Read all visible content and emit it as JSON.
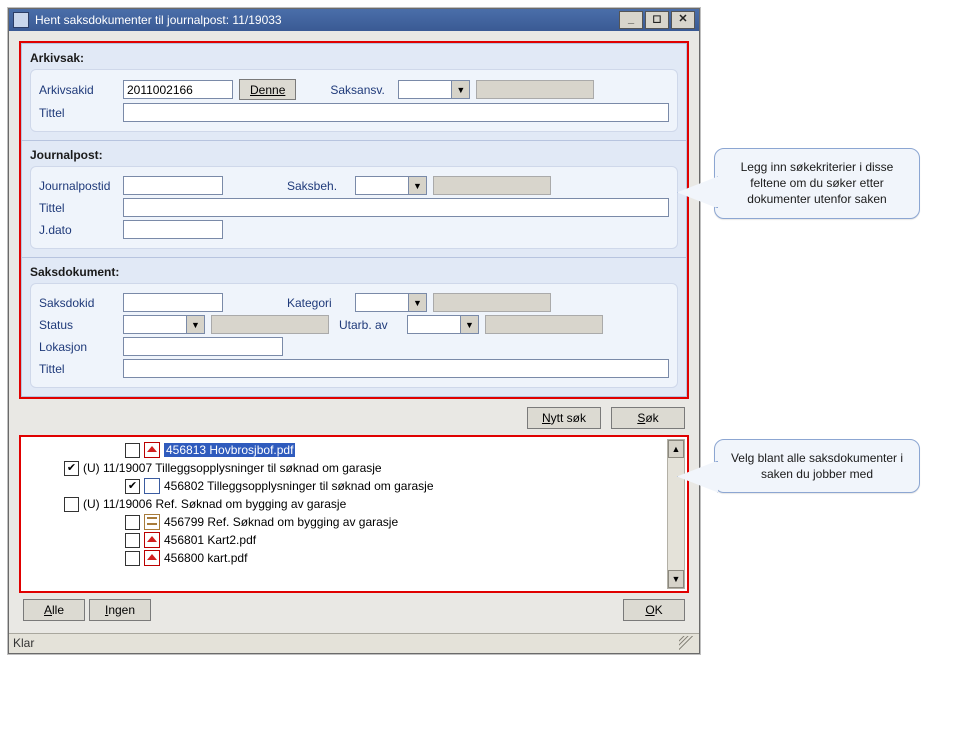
{
  "window": {
    "title": "Hent saksdokumenter til journalpost: 11/19033"
  },
  "arkivsak": {
    "title": "Arkivsak:",
    "arkivsakid_label": "Arkivsakid",
    "arkivsakid_value": "2011002166",
    "denne_label": "Denne",
    "saksansv_label": "Saksansv.",
    "saksansv_value": "",
    "tittel_label": "Tittel",
    "tittel_value": ""
  },
  "journalpost": {
    "title": "Journalpost:",
    "journalpostid_label": "Journalpostid",
    "journalpostid_value": "",
    "saksbeh_label": "Saksbeh.",
    "saksbeh_value": "",
    "tittel_label": "Tittel",
    "tittel_value": "",
    "jdato_label": "J.dato",
    "jdato_value": ""
  },
  "saksdokument": {
    "title": "Saksdokument:",
    "saksdokid_label": "Saksdokid",
    "saksdokid_value": "",
    "kategori_label": "Kategori",
    "kategori_value": "",
    "status_label": "Status",
    "status_value": "",
    "utarbav_label": "Utarb. av",
    "utarbav_value": "",
    "lokasjon_label": "Lokasjon",
    "lokasjon_value": "",
    "tittel_label": "Tittel",
    "tittel_value": ""
  },
  "buttons": {
    "nytt_sok": "Nytt søk",
    "sok": "Søk",
    "alle": "Alle",
    "ingen": "Ingen",
    "ok": "OK"
  },
  "tree": [
    {
      "indent": 3,
      "checked": false,
      "icon": "pdf",
      "selected": true,
      "label": "456813 Hovbrosjbof.pdf"
    },
    {
      "indent": 1,
      "expander": "-",
      "checked": true,
      "icon": "",
      "label": "(U) 11/19007 Tilleggsopplysninger til søknad om garasje"
    },
    {
      "indent": 3,
      "checked": true,
      "icon": "doc",
      "label": "456802 Tilleggsopplysninger til søknad om garasje"
    },
    {
      "indent": 1,
      "expander": "-",
      "checked": false,
      "icon": "",
      "label": "(U) 11/19006 Ref. Søknad om bygging av garasje"
    },
    {
      "indent": 3,
      "checked": false,
      "icon": "txt",
      "label": "456799 Ref. Søknad om bygging av garasje"
    },
    {
      "indent": 3,
      "checked": false,
      "icon": "pdf",
      "label": "456801 Kart2.pdf"
    },
    {
      "indent": 3,
      "checked": false,
      "icon": "pdf",
      "label": "456800 kart.pdf"
    }
  ],
  "status": "Klar",
  "callouts": {
    "top": "Legg inn søkekriterier i disse feltene om du søker etter dokumenter utenfor saken",
    "bottom": "Velg blant alle saksdokumenter i saken du jobber med"
  }
}
